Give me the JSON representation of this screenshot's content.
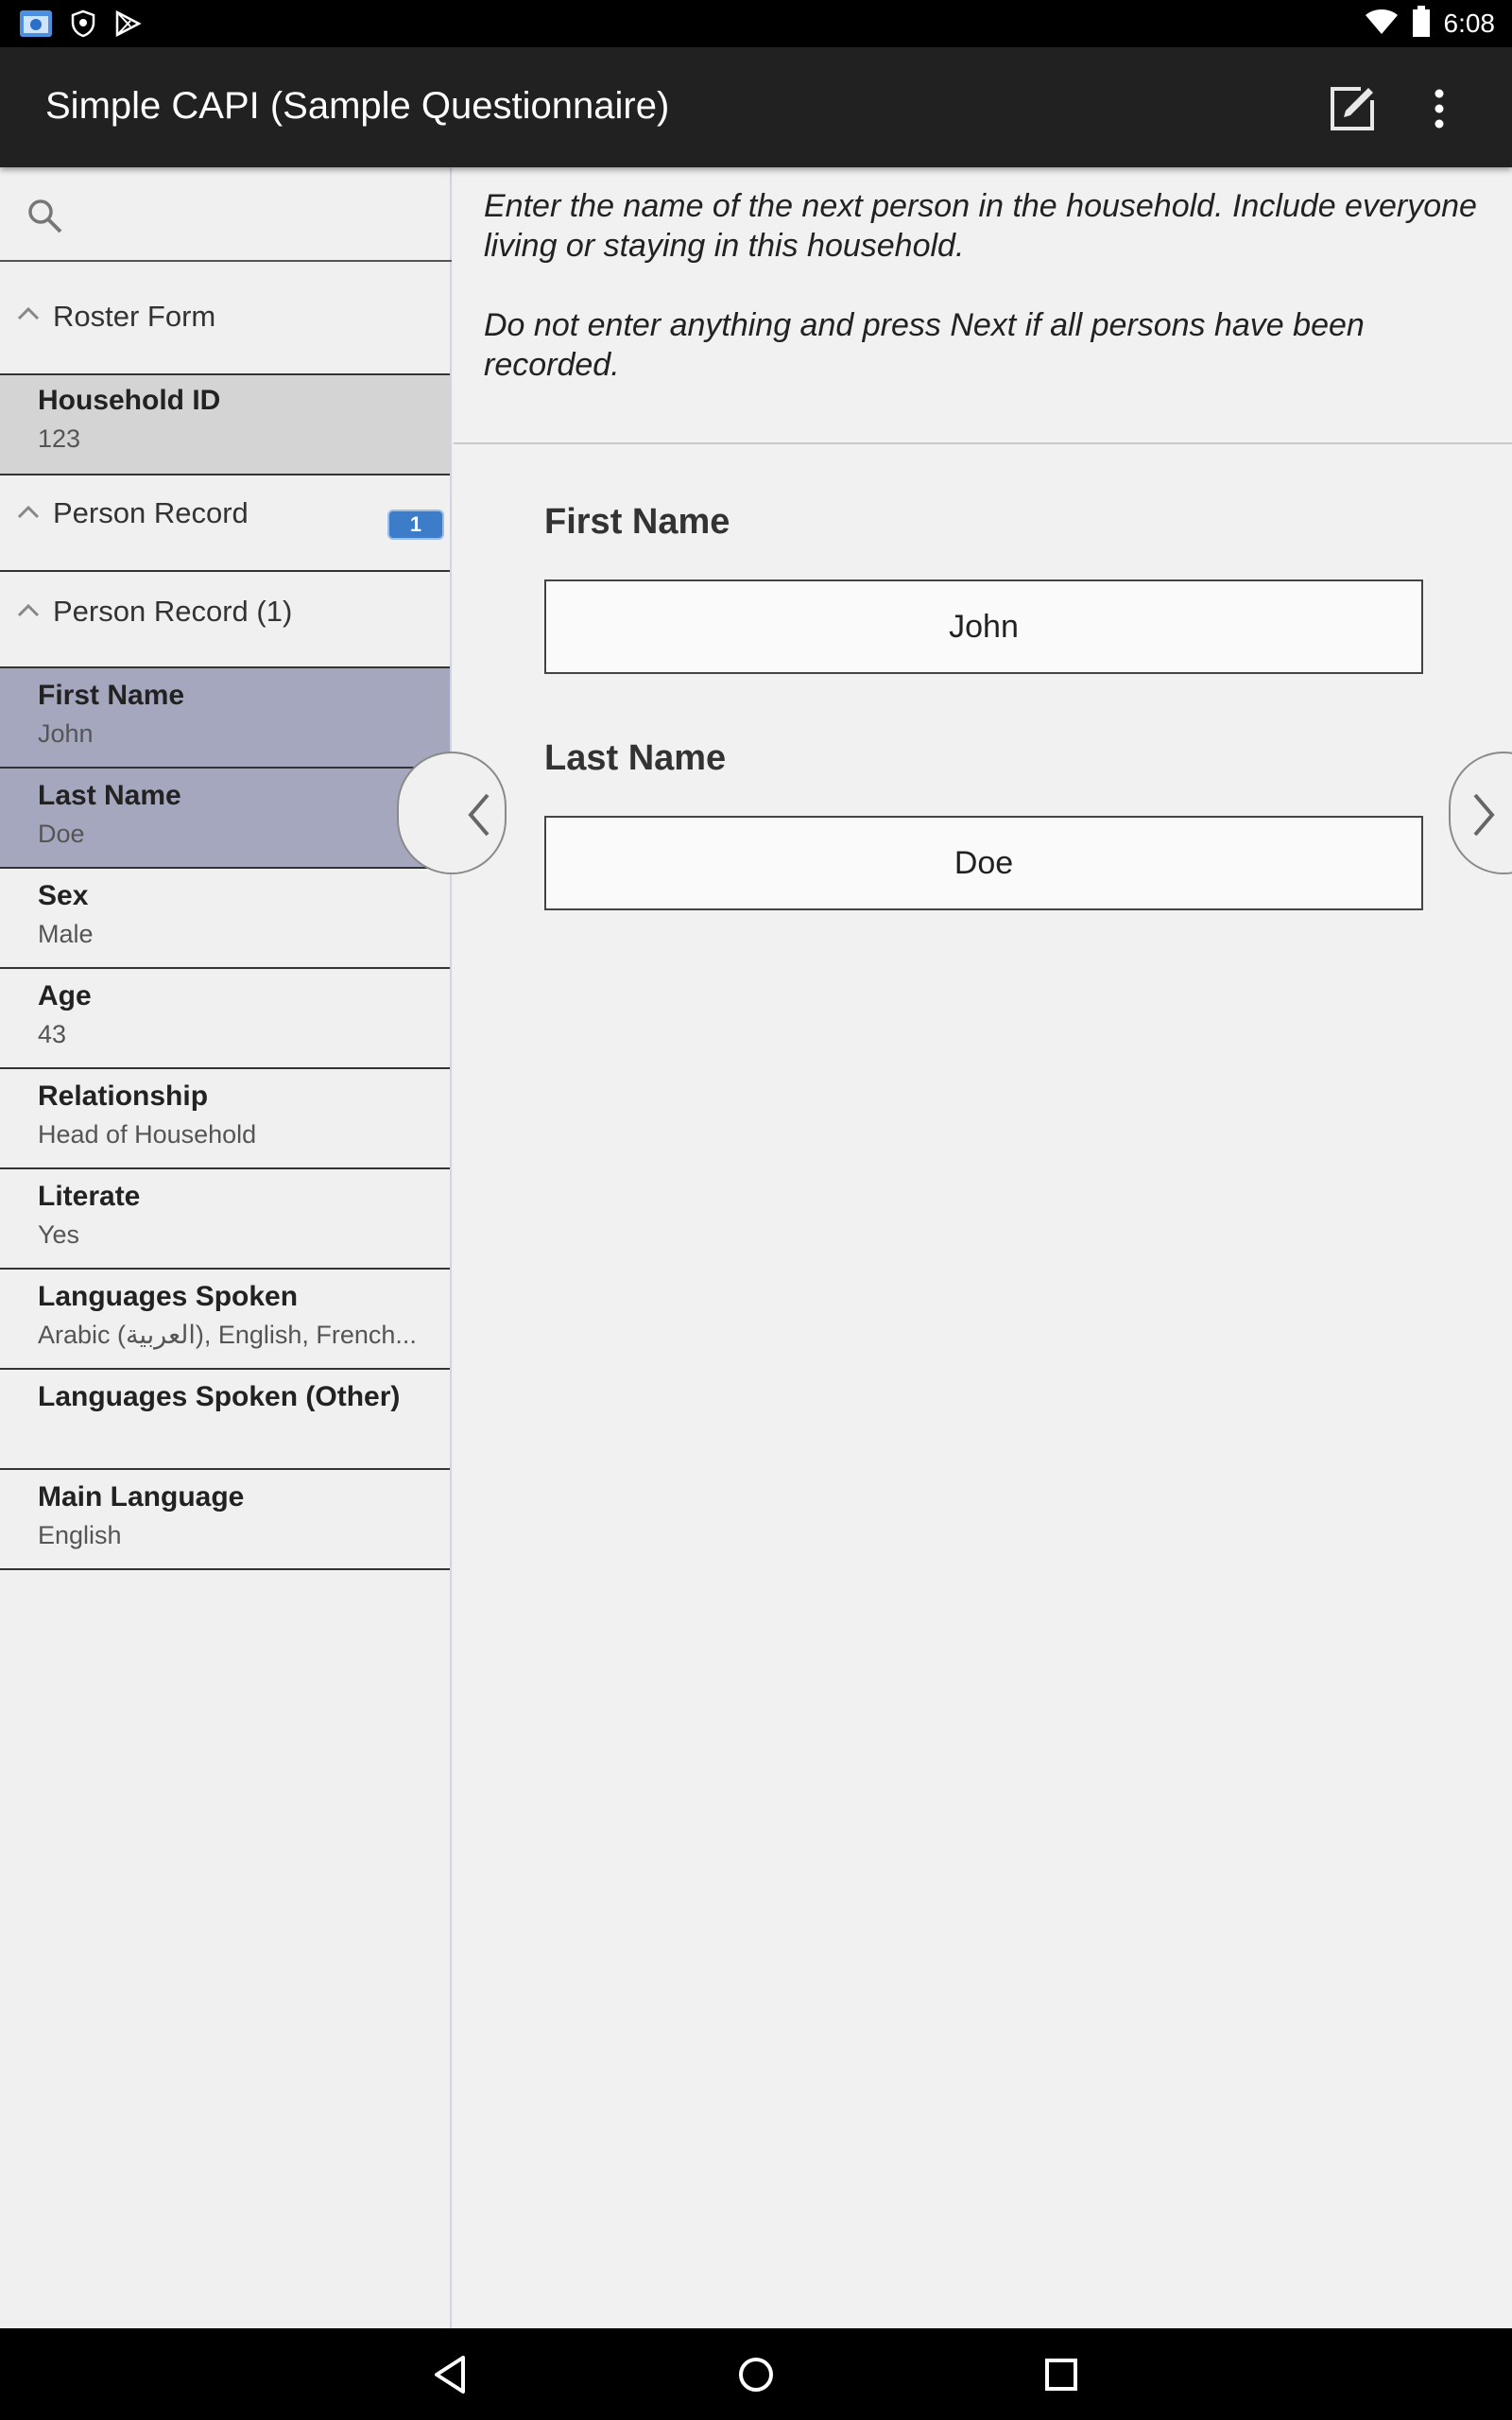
{
  "status_bar": {
    "time": "6:08",
    "left_icons": [
      "app-notification-icon",
      "shield-icon",
      "play-store-icon"
    ],
    "right_icons": [
      "wifi-icon",
      "battery-icon"
    ]
  },
  "app_bar": {
    "title": "Simple CAPI (Sample Questionnaire)",
    "actions": [
      "edit-icon",
      "overflow-menu-icon"
    ]
  },
  "sidebar": {
    "search_placeholder": "",
    "roster_form": "Roster Form",
    "household_id": {
      "label": "Household ID",
      "value": "123"
    },
    "person_record": {
      "label": "Person Record",
      "count": "1"
    },
    "person_record_1": "Person Record (1)",
    "fields": [
      {
        "label": "First Name",
        "value": "John"
      },
      {
        "label": "Last Name",
        "value": "Doe"
      },
      {
        "label": "Sex",
        "value": "Male"
      },
      {
        "label": "Age",
        "value": "43"
      },
      {
        "label": "Relationship",
        "value": "Head of Household"
      },
      {
        "label": "Literate",
        "value": "Yes"
      },
      {
        "label": "Languages Spoken",
        "value": "Arabic (العربية), English, French..."
      },
      {
        "label": "Languages Spoken (Other)",
        "value": ""
      },
      {
        "label": "Main Language",
        "value": "English"
      }
    ]
  },
  "main": {
    "question_text_1": "Enter the name of the next person in the household. Include everyone living or staying in this household.",
    "question_text_2": "Do not enter anything and press Next if all persons have been recorded.",
    "first_name": {
      "label": "First Name",
      "value": "John"
    },
    "last_name": {
      "label": "Last Name",
      "value": "Doe"
    }
  },
  "colors": {
    "app_bar": "#212121",
    "selected_item": "#a4a7be",
    "badge": "#3d7cc9"
  }
}
